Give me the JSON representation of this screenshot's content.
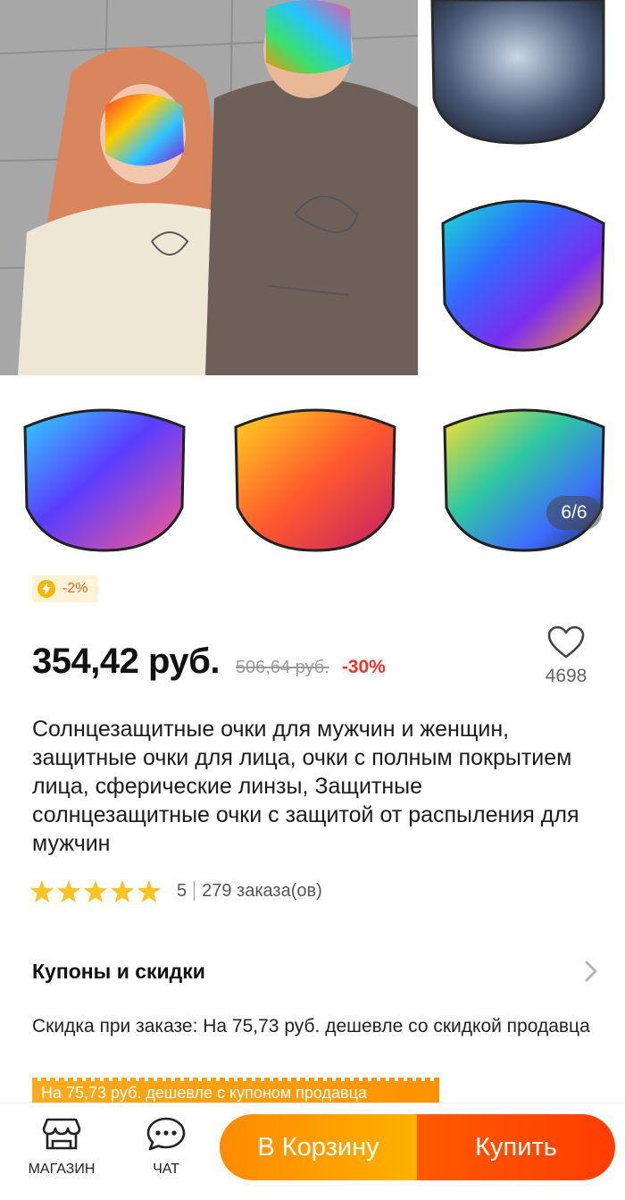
{
  "gallery": {
    "counter": "6/6",
    "photos": [
      {
        "name": "main-photo",
        "desc_icon": "people-photo"
      },
      {
        "name": "lens-photo-1"
      },
      {
        "name": "lens-photo-2"
      },
      {
        "name": "lens-photo-3"
      },
      {
        "name": "lens-photo-4"
      },
      {
        "name": "lens-photo-5"
      }
    ]
  },
  "promo": {
    "icon": "bolt-icon",
    "text": "-2%"
  },
  "product": {
    "price": "354,42 руб.",
    "old_price": "506,64 руб.",
    "discount": "-30%",
    "favorites_count": "4698",
    "title": "Солнцезащитные очки для мужчин и женщин, защитные очки для лица, очки с полным покрытием лица, сферические линзы, Защитные солнцезащитные очки с защитой от распыления для мужчин",
    "rating": "5",
    "orders": "279 заказа(ов)",
    "stars": 5
  },
  "coupons": {
    "title": "Купоны и скидки",
    "description": "Скидка при заказе: На 75,73 руб. дешевле со скидкой продавца",
    "coupon_strip": "На 75,73 руб. дешевле с купоном продавца"
  },
  "bottom_bar": {
    "store_label": "МАГАЗИН",
    "chat_label": "ЧАТ",
    "cart_button": "В Корзину",
    "buy_button": "Купить"
  },
  "colors": {
    "accent_orange": "#ff8a00",
    "buy_red": "#ff3d00",
    "discount_red": "#f0322a",
    "star_yellow": "#f7c325"
  }
}
